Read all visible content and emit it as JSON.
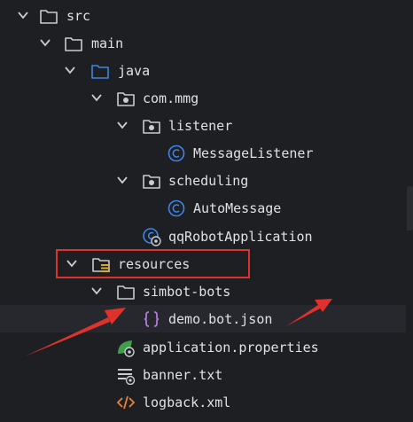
{
  "tree": {
    "items": [
      {
        "label": "src",
        "icon": "folder-icon"
      },
      {
        "label": "main",
        "icon": "folder-icon"
      },
      {
        "label": "java",
        "icon": "source-folder-icon"
      },
      {
        "label": "com.mmg",
        "icon": "package-icon"
      },
      {
        "label": "listener",
        "icon": "package-icon"
      },
      {
        "label": "MessageListener",
        "icon": "class-icon"
      },
      {
        "label": "scheduling",
        "icon": "package-icon"
      },
      {
        "label": "AutoMessage",
        "icon": "class-icon"
      },
      {
        "label": "qqRobotApplication",
        "icon": "spring-boot-class-icon"
      },
      {
        "label": "resources",
        "icon": "resources-folder-icon"
      },
      {
        "label": "simbot-bots",
        "icon": "folder-icon"
      },
      {
        "label": "demo.bot.json",
        "icon": "json-file-icon"
      },
      {
        "label": "application.properties",
        "icon": "spring-properties-icon"
      },
      {
        "label": "banner.txt",
        "icon": "text-file-icon"
      },
      {
        "label": "logback.xml",
        "icon": "xml-file-icon"
      }
    ]
  },
  "colors": {
    "background": "#1e1f22",
    "text": "#dfe1e5",
    "selection": "#26282e",
    "annotation_red": "#e0322d",
    "class_blue": "#3f84e5",
    "json_purple": "#b07cd8",
    "spring_green": "#3f9e4b",
    "xml_orange": "#e8823b"
  }
}
